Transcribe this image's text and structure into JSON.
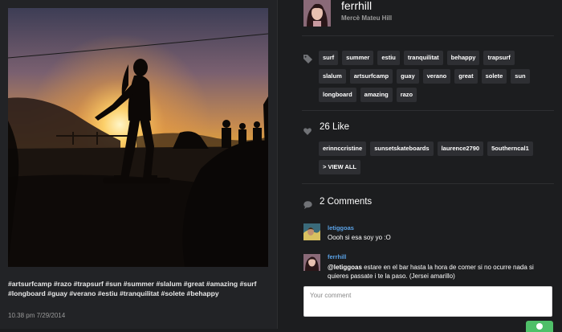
{
  "post": {
    "caption": "#artsurfcamp #razo #trapsurf #sun #summer #slalum #great #amazing #surf #longboard #guay #verano #estiu #tranquilitat #solete #behappy",
    "timestamp": "10.38 pm 7/29/2014"
  },
  "user": {
    "username": "ferrhill",
    "full_name": "Mercè Mateu Hill"
  },
  "tags": [
    "surf",
    "summer",
    "estiu",
    "tranquilitat",
    "behappy",
    "trapsurf",
    "slalum",
    "artsurfcamp",
    "guay",
    "verano",
    "great",
    "solete",
    "sun",
    "longboard",
    "amazing",
    "razo"
  ],
  "likes": {
    "title": "26 Like",
    "users": [
      "erinnccristine",
      "sunsetskateboards",
      "laurence2790",
      "5outherncal1"
    ],
    "view_all": "> VIEW ALL"
  },
  "comments": {
    "title": "2 Comments",
    "items": [
      {
        "user": "letiggoas",
        "mention": "",
        "text": "Oooh si esa soy yo :O"
      },
      {
        "user": "ferrhill",
        "mention": "@letiggoas",
        "text": " estare en el bar hasta la hora de comer si no ocurre nada si quieres passate i te la paso. (Jersei amarillo)"
      }
    ],
    "placeholder": "Your comment"
  },
  "colors": {
    "background": "#1c1d1f",
    "pill": "#2e2f33",
    "link_blue": "#5aa2e6",
    "send_green": "#4fbf68"
  },
  "icons": [
    "tag-icon",
    "heart-icon",
    "speech-bubble-icon"
  ]
}
